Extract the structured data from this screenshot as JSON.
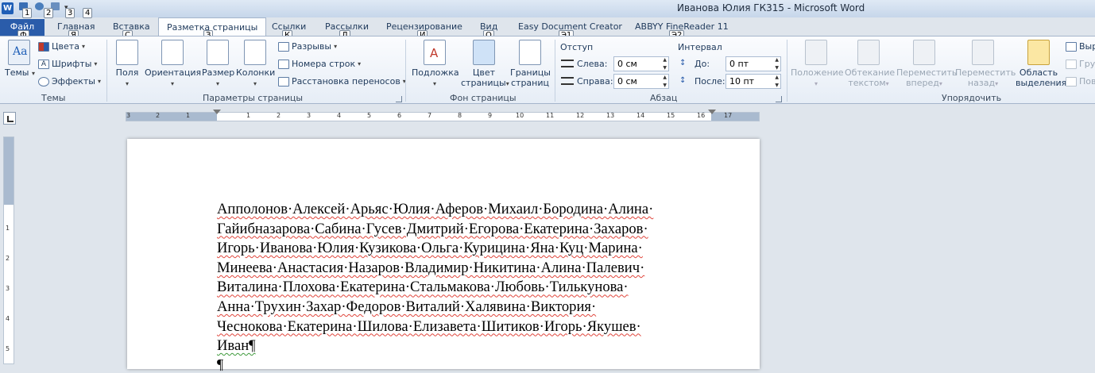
{
  "window": {
    "title": "Иванова Юлия ГК315  -  Microsoft Word",
    "app_icon": "W"
  },
  "qat": {
    "keytips": [
      "1",
      "2",
      "3",
      "4"
    ]
  },
  "tabs": [
    {
      "label": "Файл",
      "keytip": "Ф"
    },
    {
      "label": "Главная",
      "keytip": "Я"
    },
    {
      "label": "Вставка",
      "keytip": "С"
    },
    {
      "label": "Разметка страницы",
      "keytip": "З"
    },
    {
      "label": "Ссылки",
      "keytip": "К"
    },
    {
      "label": "Рассылки",
      "keytip": "Л"
    },
    {
      "label": "Рецензирование",
      "keytip": "И"
    },
    {
      "label": "Вид",
      "keytip": "О"
    },
    {
      "label": "Easy Document Creator",
      "keytip": "Э1"
    },
    {
      "label": "ABBYY FineReader 11",
      "keytip": "Э2"
    }
  ],
  "ribbon": {
    "themes": {
      "group": "Темы",
      "themes_btn": "Темы",
      "colors": "Цвета",
      "fonts": "Шрифты",
      "effects": "Эффекты"
    },
    "page_setup": {
      "group": "Параметры страницы",
      "margins": "Поля",
      "orientation": "Ориентация",
      "size": "Размер",
      "columns": "Колонки",
      "breaks": "Разрывы",
      "line_numbers": "Номера строк",
      "hyphenation": "Расстановка переносов"
    },
    "page_background": {
      "group": "Фон страницы",
      "watermark": "Подложка",
      "page_color_1": "Цвет",
      "page_color_2": "страницы",
      "page_borders_1": "Границы",
      "page_borders_2": "страниц"
    },
    "paragraph": {
      "group": "Абзац",
      "indent_label": "Отступ",
      "left_label": "Слева:",
      "left_value": "0 см",
      "right_label": "Справа:",
      "right_value": "0 см",
      "spacing_label": "Интервал",
      "before_label": "До:",
      "before_value": "0 пт",
      "after_label": "После:",
      "after_value": "10 пт"
    },
    "arrange": {
      "group": "Упорядочить",
      "position": "Положение",
      "wrap_1": "Обтекание",
      "wrap_2": "текстом",
      "forward_1": "Переместить",
      "forward_2": "вперед",
      "backward_1": "Переместить",
      "backward_2": "назад",
      "selection_1": "Область",
      "selection_2": "выделения",
      "align": "Выр",
      "group_btn": "Гру",
      "rotate": "Пов"
    }
  },
  "ruler": {
    "h_numbers": [
      "3",
      "2",
      "1",
      "1",
      "2",
      "3",
      "4",
      "5",
      "6",
      "7",
      "8",
      "9",
      "10",
      "11",
      "12",
      "13",
      "14",
      "15",
      "16",
      "17"
    ],
    "v_numbers": [
      "1",
      "2",
      "3",
      "4",
      "5"
    ]
  },
  "document": {
    "lines": [
      "Апполонов·Алексей·Арьяс·Юлия·Аферов·Михаил·Бородина·Алина·",
      "Гайибназарова·Сабина·Гусев·Дмитрий·Егорова·Екатерина·Захаров·",
      "Игорь·Иванова·Юлия·Кузикова·Ольга·Курицина·Яна·Куц·Марина·",
      "Минеева·Анастасия·Назаров·Владимир·Никитина·Алина·Палевич·",
      "Виталина·Плохова·Екатерина·Стальмакова·Любовь·Тилькунова·",
      "Анна·Трухин·Захар·Федоров·Виталий·Халявина·Виктория·",
      "Чеснокова·Екатерина·Шилова·Елизавета·Шитиков·Игорь·Якушев·",
      "Иван¶"
    ],
    "empty_paragraph": "¶"
  }
}
